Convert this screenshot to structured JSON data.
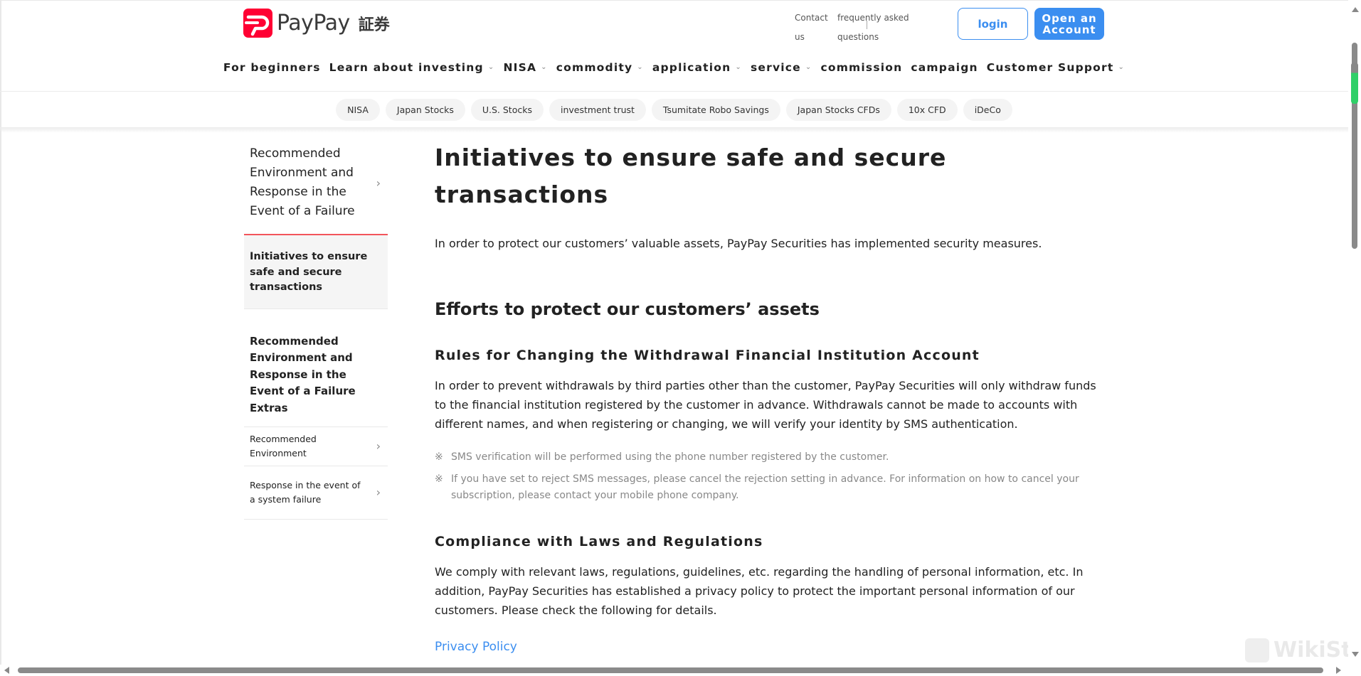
{
  "brand": {
    "name": "PayPay",
    "suffix": "証券",
    "color": "#ff0033"
  },
  "header": {
    "util_links": [
      {
        "label": "Contact us"
      },
      {
        "label": "frequently asked questions"
      }
    ],
    "login_label": "login",
    "open_account_label": "Open an Account",
    "accent_color": "#3b8ef0"
  },
  "main_nav": [
    {
      "label": "For beginners",
      "has_dropdown": false
    },
    {
      "label": "Learn about investing",
      "has_dropdown": true
    },
    {
      "label": "NISA",
      "has_dropdown": true
    },
    {
      "label": "commodity",
      "has_dropdown": true
    },
    {
      "label": "application",
      "has_dropdown": true
    },
    {
      "label": "service",
      "has_dropdown": true
    },
    {
      "label": "commission",
      "has_dropdown": false
    },
    {
      "label": "campaign",
      "has_dropdown": false
    },
    {
      "label": "Customer Support",
      "has_dropdown": true
    }
  ],
  "sub_nav": [
    "NISA",
    "Japan Stocks",
    "U.S. Stocks",
    "investment trust",
    "Tsumitate Robo Savings",
    "Japan Stocks CFDs",
    "10x CFD",
    "iDeCo"
  ],
  "sidebar": {
    "parent": "Recommended Environment and Response in the Event of a Failure",
    "active": "Initiatives to ensure safe and secure transactions",
    "group_title": "Recommended Environment and Response in the Event of a Failure Extras",
    "children": [
      "Recommended Environment",
      "Response in the event of a system failure"
    ],
    "active_border_color": "#f2545b"
  },
  "content": {
    "title": "Initiatives to ensure safe and secure transactions",
    "intro": "In order to protect our customers’ valuable assets, PayPay Securities has implemented security measures.",
    "section_title": "Efforts to protect our customers’ assets",
    "subsections": [
      {
        "title": "Rules for Changing the Withdrawal Financial Institution Account",
        "body": "In order to prevent withdrawals by third parties other than the customer, PayPay Securities will only withdraw funds to the financial institution registered by the customer in advance. Withdrawals cannot be made to accounts with different names, and when registering or changing, we will verify your identity by SMS authentication.",
        "notes": [
          {
            "mark": "※",
            "text": "SMS verification will be performed using the phone number registered by the customer."
          },
          {
            "mark": "※",
            "text": "If you have set to reject SMS messages, please cancel the rejection setting in advance. For information on how to cancel your subscription, please contact your mobile phone company."
          }
        ]
      },
      {
        "title": "Compliance with Laws and Regulations",
        "body": "We comply with relevant laws, regulations, guidelines, etc. regarding the handling of personal information, etc. In addition, PayPay Securities has established a privacy policy to protect the important personal information of our customers. Please check the following for details.",
        "link": "Privacy Policy"
      }
    ]
  },
  "watermark": "WikiStock"
}
